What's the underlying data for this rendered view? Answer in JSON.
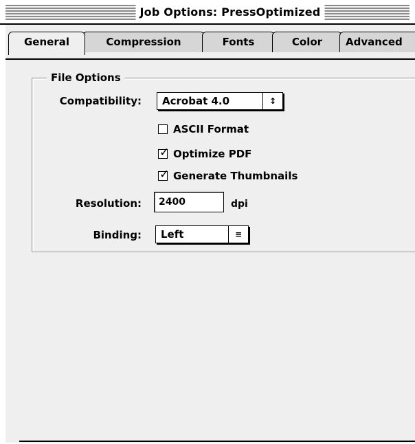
{
  "window": {
    "title": "Job Options: PressOptimized"
  },
  "tabs": [
    {
      "label": "General",
      "active": true
    },
    {
      "label": "Compression",
      "active": false
    },
    {
      "label": "Fonts",
      "active": false
    },
    {
      "label": "Color",
      "active": false
    },
    {
      "label": "Advanced",
      "active": false
    }
  ],
  "file_options": {
    "legend": "File Options",
    "compatibility": {
      "label": "Compatibility:",
      "value": "Acrobat 4.0",
      "arrow_glyph": "↕"
    },
    "checkboxes": [
      {
        "label": "ASCII Format",
        "checked": false,
        "mark": ""
      },
      {
        "label": "Optimize PDF",
        "checked": true,
        "mark": "✓"
      },
      {
        "label": "Generate Thumbnails",
        "checked": true,
        "mark": "✓"
      }
    ],
    "resolution": {
      "label": "Resolution:",
      "value": "2400",
      "unit": "dpi"
    },
    "binding": {
      "label": "Binding:",
      "value": "Left",
      "arrow_glyph": "≡"
    }
  }
}
